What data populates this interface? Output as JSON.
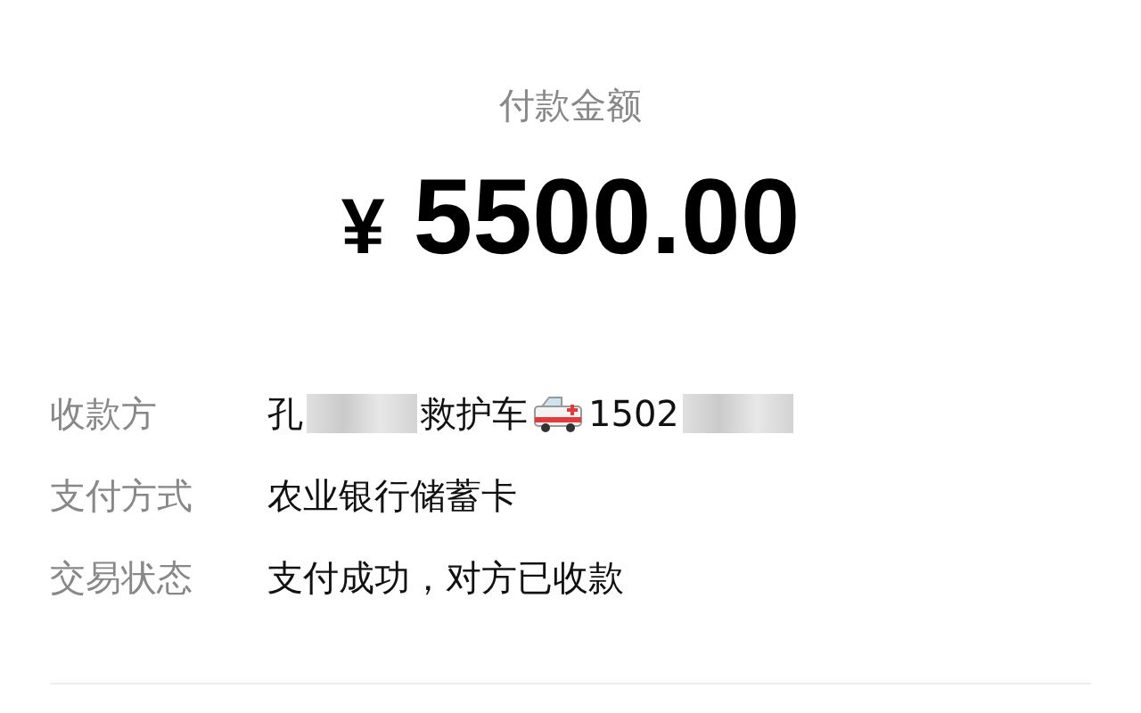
{
  "title": "付款金额",
  "amount": {
    "currency": "¥",
    "value": "5500.00"
  },
  "rows": [
    {
      "label": "收款方",
      "parts": [
        {
          "kind": "text",
          "text": "孔"
        },
        {
          "kind": "redacted"
        },
        {
          "kind": "text",
          "text": "救护车"
        },
        {
          "kind": "icon"
        },
        {
          "kind": "text",
          "text": "1502"
        },
        {
          "kind": "redacted"
        }
      ]
    },
    {
      "label": "支付方式",
      "parts": [
        {
          "kind": "text",
          "text": "农业银行储蓄卡"
        }
      ]
    },
    {
      "label": "交易状态",
      "parts": [
        {
          "kind": "text",
          "text": "支付成功，对方已收款"
        }
      ]
    }
  ]
}
